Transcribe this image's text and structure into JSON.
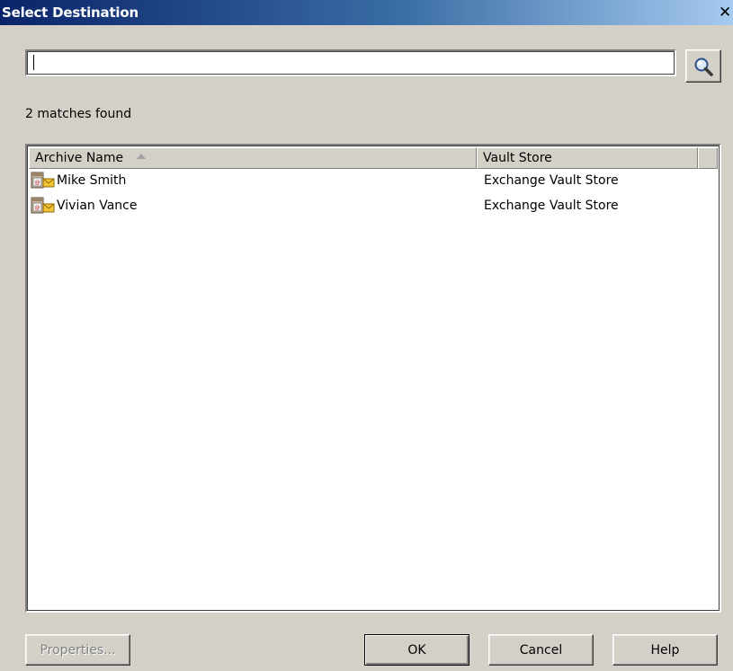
{
  "window": {
    "title": "Select Destination",
    "close_glyph": "✕"
  },
  "search": {
    "value": "",
    "placeholder": "",
    "button_icon": "search-icon"
  },
  "status": {
    "matches_text": "2 matches found"
  },
  "table": {
    "columns": [
      {
        "label": "Archive Name",
        "sort": "ascending"
      },
      {
        "label": "Vault Store"
      }
    ],
    "rows": [
      {
        "archive_name": "Mike Smith",
        "vault_store": "Exchange Vault Store",
        "icon": "archive-mailbox-icon"
      },
      {
        "archive_name": "Vivian Vance",
        "vault_store": "Exchange Vault Store",
        "icon": "archive-mailbox-icon"
      }
    ]
  },
  "buttons": {
    "properties": "Properties...",
    "ok": "OK",
    "cancel": "Cancel",
    "help": "Help"
  },
  "colors": {
    "title_gradient_start": "#0a246a",
    "title_gradient_end": "#a6caf0",
    "dialog_face": "#d4d0c8"
  }
}
